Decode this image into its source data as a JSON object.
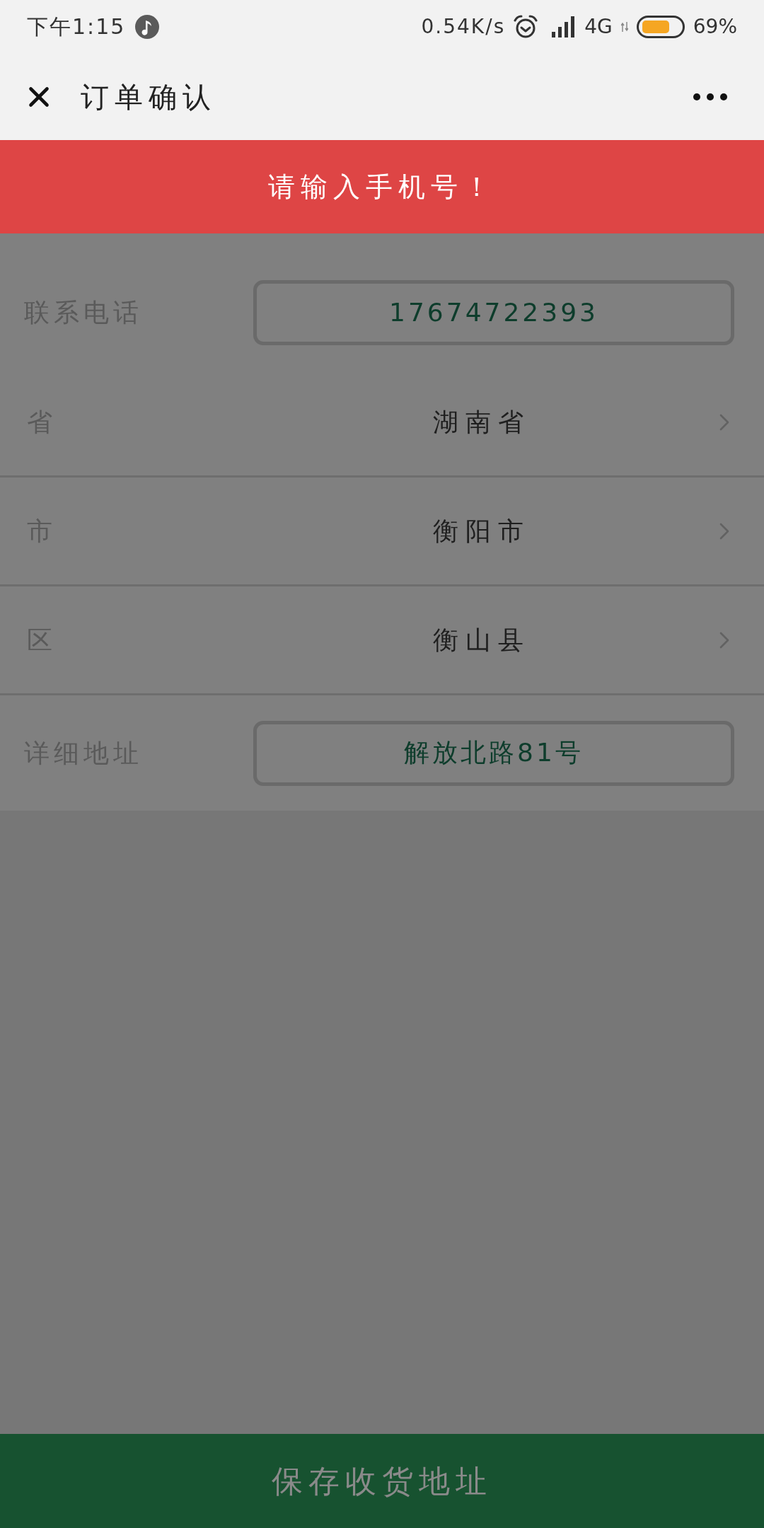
{
  "status_bar": {
    "time": "下午1:15",
    "network_speed": "0.54K/s",
    "network_type": "4G",
    "battery_percent": "69%"
  },
  "header": {
    "title": "订单确认"
  },
  "toast": {
    "message": "请输入手机号！",
    "mask": true
  },
  "form": {
    "rows": [
      {
        "kind": "input",
        "label": "联系电话",
        "value": "17674722393"
      },
      {
        "kind": "select",
        "label": "省",
        "value": "湖南省"
      },
      {
        "kind": "select",
        "label": "市",
        "value": "衡阳市"
      },
      {
        "kind": "select",
        "label": "区",
        "value": "衡山县"
      },
      {
        "kind": "input",
        "label": "详细地址",
        "value": "解放北路81号"
      }
    ]
  },
  "save_button": {
    "label": "保存收货地址"
  }
}
